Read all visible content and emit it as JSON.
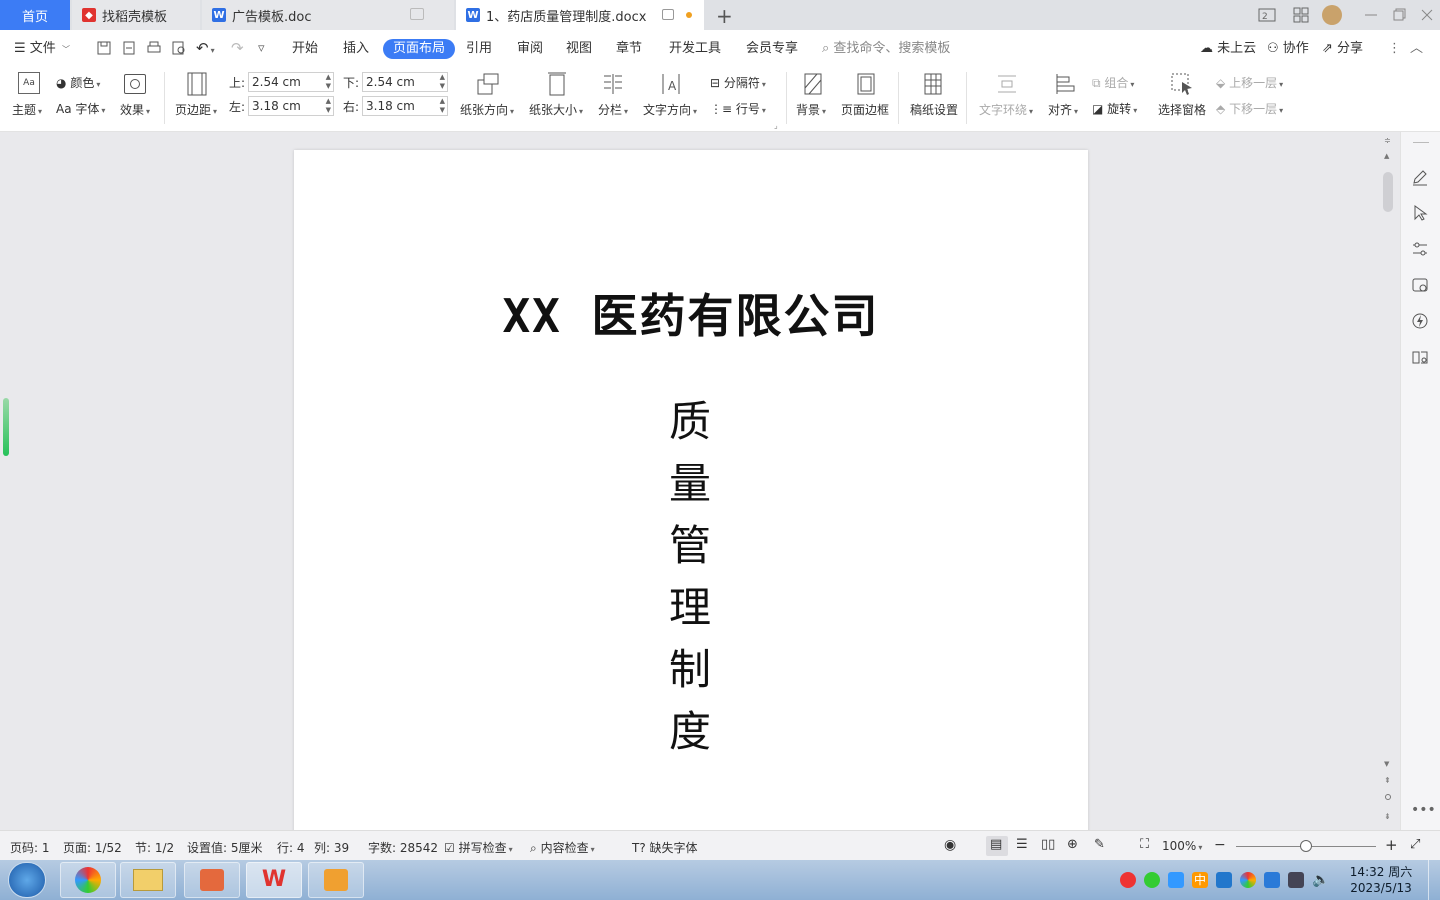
{
  "tabs": {
    "home": "首页",
    "t1": "找稻壳模板",
    "t2": "广告模板.doc",
    "t3": "1、药店质量管理制度.docx"
  },
  "menu": {
    "file": "文件",
    "items": [
      "开始",
      "插入",
      "页面布局",
      "引用",
      "审阅",
      "视图",
      "章节",
      "开发工具",
      "会员专享"
    ],
    "active": "页面布局",
    "search_placeholder": "查找命令、搜索模板",
    "cloud": "未上云",
    "collab": "协作",
    "share": "分享"
  },
  "ribbon": {
    "theme": "主题",
    "color": "颜色",
    "font": "字体",
    "effect": "效果",
    "margins": "页边距",
    "top_label": "上:",
    "top_val": "2.54 cm",
    "bottom_label": "下:",
    "bottom_val": "2.54 cm",
    "left_label": "左:",
    "left_val": "3.18 cm",
    "right_label": "右:",
    "right_val": "3.18 cm",
    "orientation": "纸张方向",
    "size": "纸张大小",
    "columns": "分栏",
    "text_dir": "文字方向",
    "breaks": "分隔符",
    "line_num": "行号",
    "background": "背景",
    "page_border": "页面边框",
    "manuscript": "稿纸设置",
    "wrap": "文字环绕",
    "align": "对齐",
    "group": "组合",
    "rotate": "旋转",
    "select_pane": "选择窗格",
    "bring_fwd": "上移一层",
    "send_back": "下移一层"
  },
  "document": {
    "title": "XX 医药有限公司",
    "vertical": [
      "质",
      "量",
      "管",
      "理",
      "制",
      "度"
    ]
  },
  "status": {
    "page_code": "页码: 1",
    "page": "页面: 1/52",
    "section": "节: 1/2",
    "setting": "设置值: 5厘米",
    "row": "行: 4",
    "col": "列: 39",
    "words": "字数: 28542",
    "spell": "拼写检查",
    "content": "内容检查",
    "missing_font": "缺失字体",
    "zoom": "100%"
  },
  "taskbar": {
    "time": "14:32 周六",
    "date": "2023/5/13",
    "ime": "中"
  },
  "colors": {
    "accent": "#3c7cf5",
    "wps_red": "#e0332f"
  }
}
